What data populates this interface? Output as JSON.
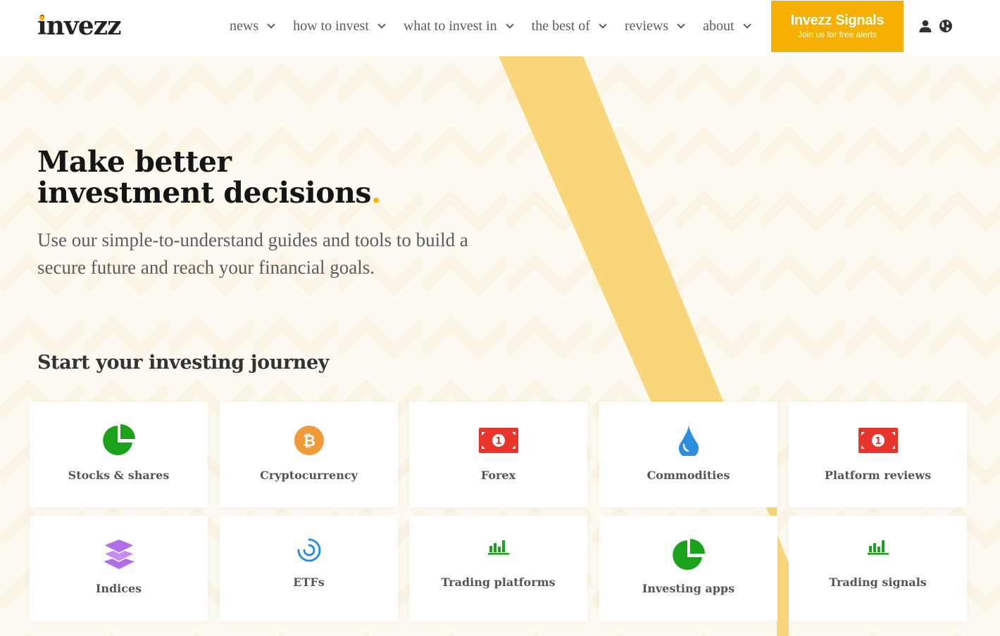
{
  "header": {
    "logo_text": "invezz",
    "nav": [
      {
        "label": "news"
      },
      {
        "label": "how to invest"
      },
      {
        "label": "what to invest in"
      },
      {
        "label": "the best of"
      },
      {
        "label": "reviews"
      },
      {
        "label": "about"
      }
    ],
    "cta": {
      "title": "Invezz Signals",
      "subtitle": "Join us for free alerts"
    },
    "icons": [
      "user-icon",
      "globe-icon"
    ]
  },
  "hero": {
    "headline_line1": "Make better",
    "headline_line2": "investment decisions",
    "headline_dot": ".",
    "subheadline": "Use our simple-to-understand guides and tools to build a secure future and reach your financial goals."
  },
  "journey": {
    "title": "Start your investing journey",
    "cards": [
      {
        "label": "Stocks & shares",
        "icon": "pie-chart-icon"
      },
      {
        "label": "Cryptocurrency",
        "icon": "bitcoin-icon"
      },
      {
        "label": "Forex",
        "icon": "banknote-icon"
      },
      {
        "label": "Commodities",
        "icon": "droplet-icon"
      },
      {
        "label": "Platform reviews",
        "icon": "banknote-icon"
      },
      {
        "label": "Indices",
        "icon": "layers-icon"
      },
      {
        "label": "ETFs",
        "icon": "spiral-icon"
      },
      {
        "label": "Trading platforms",
        "icon": "bar-chart-icon"
      },
      {
        "label": "Investing apps",
        "icon": "pie-chart-icon"
      },
      {
        "label": "Trading signals",
        "icon": "bar-chart-icon"
      }
    ]
  },
  "colors": {
    "brand_yellow": "#f6b000",
    "stripe_yellow": "#fad67a",
    "green": "#1aa31a",
    "orange": "#f09a38",
    "red": "#e8352c",
    "blue": "#2d8ee0",
    "purple": "#b06fe8"
  }
}
